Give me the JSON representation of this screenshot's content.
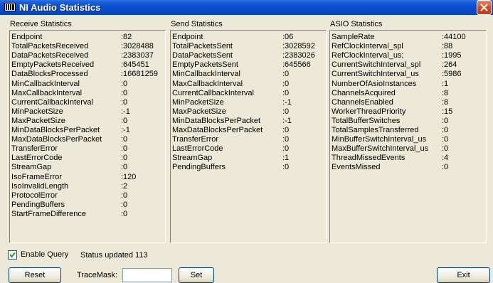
{
  "window": {
    "title": "NI Audio Statistics"
  },
  "panels": [
    {
      "title": "Receive Statistics",
      "rows": [
        {
          "k": "Endpoint",
          "v": ":82"
        },
        {
          "k": "TotalPacketsReceived",
          "v": ":3028488"
        },
        {
          "k": "DataPacketsReceived",
          "v": ":2383037"
        },
        {
          "k": "EmptyPacketsReceived",
          "v": ":645451"
        },
        {
          "k": "DataBlocksProcessed",
          "v": ":16681259"
        },
        {
          "k": "MinCallbackInterval",
          "v": ":0"
        },
        {
          "k": "MaxCallbackInterval",
          "v": ":0"
        },
        {
          "k": "CurrentCallbackInterval",
          "v": ":0"
        },
        {
          "k": "MinPacketSize",
          "v": ":-1"
        },
        {
          "k": "MaxPacketSize",
          "v": ":0"
        },
        {
          "k": "MinDataBlocksPerPacket",
          "v": ":-1"
        },
        {
          "k": "MaxDataBlocksPerPacket",
          "v": ":0"
        },
        {
          "k": "TransferError",
          "v": ":0"
        },
        {
          "k": "LastErrorCode",
          "v": ":0"
        },
        {
          "k": "StreamGap",
          "v": ":0"
        },
        {
          "k": "IsoFrameError",
          "v": ":120"
        },
        {
          "k": "IsoInvalidLength",
          "v": ":2"
        },
        {
          "k": "ProtocolError",
          "v": ":0"
        },
        {
          "k": "PendingBuffers",
          "v": ":0"
        },
        {
          "k": "StartFrameDifference",
          "v": ":0"
        }
      ]
    },
    {
      "title": "Send Statistics",
      "rows": [
        {
          "k": "Endpoint",
          "v": ":06"
        },
        {
          "k": "TotalPacketsSent",
          "v": ":3028592"
        },
        {
          "k": "DataPacketsSent",
          "v": ":2383026"
        },
        {
          "k": "EmptyPacketsSent",
          "v": ":645566"
        },
        {
          "k": "MinCallbackInterval",
          "v": ":0"
        },
        {
          "k": "MaxCallbackInterval",
          "v": ":0"
        },
        {
          "k": "CurrentCallbackInterval",
          "v": ":0"
        },
        {
          "k": "MinPacketSize",
          "v": ":-1"
        },
        {
          "k": "MaxPacketSize",
          "v": ":0"
        },
        {
          "k": "MinDataBlocksPerPacket",
          "v": ":-1"
        },
        {
          "k": "MaxDataBlocksPerPacket",
          "v": ":0"
        },
        {
          "k": "TransferError",
          "v": ":0"
        },
        {
          "k": "LastErrorCode",
          "v": ":0"
        },
        {
          "k": "StreamGap",
          "v": ":1"
        },
        {
          "k": "PendingBuffers",
          "v": ":0"
        }
      ]
    },
    {
      "title": "ASIO Statistics",
      "rows": [
        {
          "k": "SampleRate",
          "v": ":44100"
        },
        {
          "k": "RefClockInterval_spl",
          "v": ":88"
        },
        {
          "k": "RefClockInterval_us;",
          "v": ":1995"
        },
        {
          "k": "CurrentSwitchInterval_spl",
          "v": ":264"
        },
        {
          "k": "CurrentSwitchInterval_us",
          "v": ":5986"
        },
        {
          "k": "NumberOfAsioInstances",
          "v": ":1"
        },
        {
          "k": "ChannelsAcquired",
          "v": ":8"
        },
        {
          "k": "ChannelsEnabled",
          "v": ":8"
        },
        {
          "k": "WorkerThreadPriority",
          "v": ":15"
        },
        {
          "k": "TotalBufferSwitches",
          "v": ":0"
        },
        {
          "k": "TotalSamplesTransferred",
          "v": ":0"
        },
        {
          "k": "MinBufferSwitchInterval_us",
          "v": ":0"
        },
        {
          "k": "MaxBufferSwitchInterval_us",
          "v": ":0"
        },
        {
          "k": "ThreadMissedEvents",
          "v": ":4"
        },
        {
          "k": "EventsMissed",
          "v": ":0"
        }
      ]
    }
  ],
  "controls": {
    "enable_query_label": "Enable Query",
    "enable_query_checked": true,
    "status_text": "Status updated 113",
    "reset_label": "Reset",
    "tracemask_label": "TraceMask:",
    "tracemask_value": "",
    "set_label": "Set",
    "exit_label": "Exit"
  },
  "icons": {
    "title_icon": "app-icon",
    "close": "close-icon",
    "check": "check-icon"
  }
}
